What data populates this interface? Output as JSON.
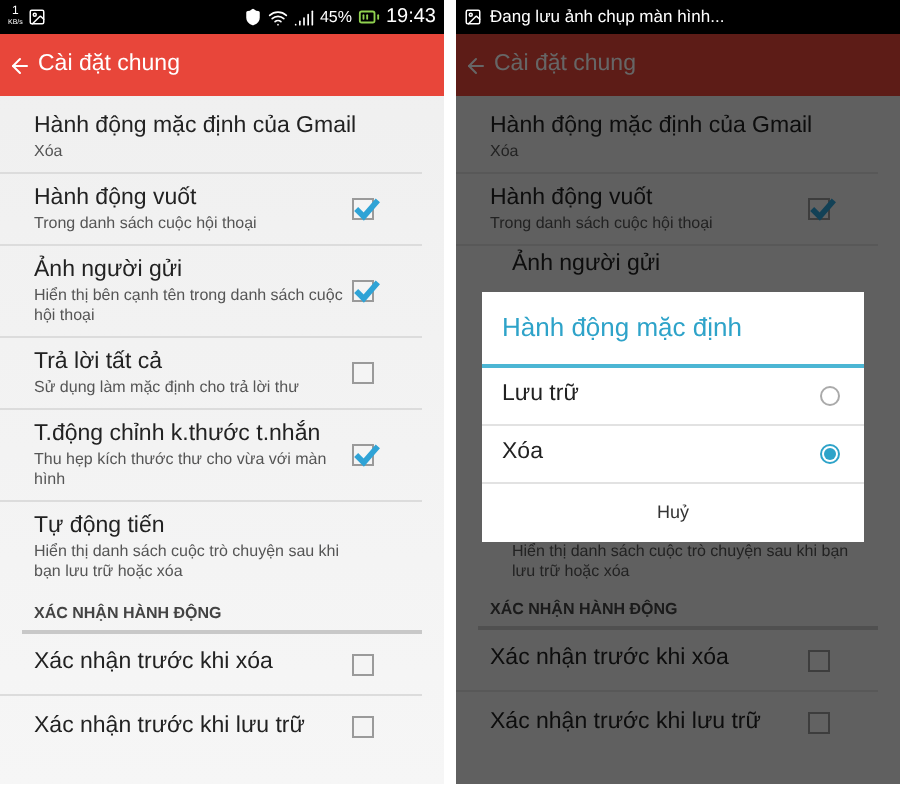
{
  "left": {
    "status_bar": {
      "speed": "1",
      "speed_unit": "KB/s",
      "battery": "45%",
      "time": "19:43"
    },
    "app_bar": {
      "title": "Cài đặt chung"
    },
    "settings": [
      {
        "kind": "value",
        "title": "Hành động mặc định của Gmail",
        "subtitle": "Xóa"
      },
      {
        "kind": "check",
        "title": "Hành động vuốt",
        "subtitle": "Trong danh sách cuộc hội thoại",
        "checked": true
      },
      {
        "kind": "check",
        "title": "Ảnh người gửi",
        "subtitle": "Hiển thị bên cạnh tên trong danh sách cuộc hội thoại",
        "checked": true
      },
      {
        "kind": "check",
        "title": "Trả lời tất cả",
        "subtitle": "Sử dụng làm mặc định cho trả lời thư",
        "checked": false
      },
      {
        "kind": "check",
        "title": "T.động chỉnh k.thước t.nhắn",
        "subtitle": "Thu hẹp kích thước thư cho vừa với màn hình",
        "checked": true
      },
      {
        "kind": "value",
        "title": "Tự động tiến",
        "subtitle": "Hiển thị danh sách cuộc trò chuyện sau khi bạn lưu trữ hoặc xóa"
      }
    ],
    "section": "XÁC NHẬN HÀNH ĐỘNG",
    "confirm": [
      {
        "title": "Xác nhận trước khi xóa",
        "checked": false
      },
      {
        "title": "Xác nhận trước khi lưu trữ",
        "checked": false
      }
    ]
  },
  "right": {
    "status_bar": {
      "notification": "Đang lưu ảnh chụp màn hình..."
    },
    "app_bar": {
      "title": "Cài đặt chung"
    },
    "settings": [
      {
        "kind": "value",
        "title": "Hành động mặc định của Gmail",
        "subtitle": "Xóa"
      },
      {
        "kind": "check",
        "title": "Hành động vuốt",
        "subtitle": "Trong danh sách cuộc hội thoại",
        "checked": true
      },
      {
        "kind": "cut",
        "title": "Ảnh người gửi"
      }
    ],
    "after_dialog": {
      "subtitle": "Hiển thị danh sách cuộc trò chuyện sau khi bạn lưu trữ hoặc xóa"
    },
    "section": "XÁC NHẬN HÀNH ĐỘNG",
    "confirm": [
      {
        "title": "Xác nhận trước khi xóa",
        "checked": false
      },
      {
        "title": "Xác nhận trước khi lưu trữ",
        "checked": false
      }
    ],
    "dialog": {
      "title": "Hành động mặc định",
      "options": [
        {
          "label": "Lưu trữ",
          "selected": false
        },
        {
          "label": "Xóa",
          "selected": true
        }
      ],
      "cancel": "Huỷ"
    }
  }
}
